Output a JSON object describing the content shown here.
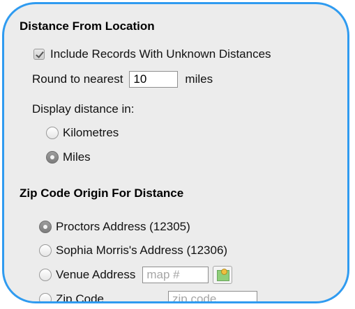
{
  "distance_section": {
    "title": "Distance From Location",
    "include_unknown_label": "Include Records With Unknown Distances",
    "include_unknown_checked": true,
    "round_label": "Round to nearest",
    "round_value": "10",
    "round_unit": "miles",
    "display_label": "Display distance in:",
    "units": [
      {
        "label": "Kilometres",
        "selected": false
      },
      {
        "label": "Miles",
        "selected": true
      }
    ]
  },
  "zip_section": {
    "title": "Zip Code Origin For Distance",
    "options": [
      {
        "label": "Proctors Address (12305)",
        "selected": true
      },
      {
        "label": "Sophia Morris's Address (12306)",
        "selected": false
      },
      {
        "label": "Venue Address",
        "selected": false
      },
      {
        "label": "Zip Code",
        "selected": false
      }
    ],
    "map_placeholder": "map #",
    "zip_placeholder": "zip code"
  },
  "colors": {
    "highlight_border": "#2f9bf0",
    "panel_background": "#ececec"
  }
}
